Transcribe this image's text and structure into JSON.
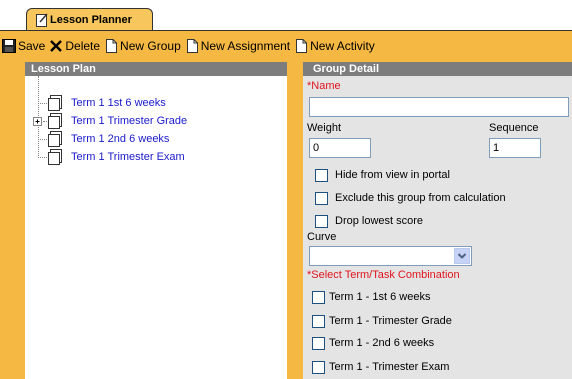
{
  "tab": {
    "label": "Lesson Planner",
    "icon": "pencil-note-icon"
  },
  "toolbar": {
    "save": "Save",
    "delete": "Delete",
    "new_group": "New Group",
    "new_assignment": "New Assignment",
    "new_activity": "New Activity"
  },
  "lesson_plan": {
    "header": "Lesson Plan",
    "items": [
      {
        "label": "Term 1 1st 6 weeks"
      },
      {
        "label": "Term 1 Trimester Grade"
      },
      {
        "label": "Term 1 2nd 6 weeks"
      },
      {
        "label": "Term 1 Trimester Exam"
      }
    ]
  },
  "group_detail": {
    "header": "Group Detail",
    "name_label": "*Name",
    "name_value": "",
    "weight_label": "Weight",
    "weight_value": "0",
    "sequence_label": "Sequence",
    "sequence_value": "1",
    "hide_label": "Hide from view in portal",
    "exclude_label": "Exclude this group from calculation",
    "drop_label": "Drop lowest score",
    "curve_label": "Curve",
    "curve_value": "",
    "term_task_label": "*Select Term/Task Combination",
    "terms": [
      {
        "label": "Term 1 - 1st 6 weeks"
      },
      {
        "label": "Term 1 - Trimester Grade"
      },
      {
        "label": "Term 1 - 2nd 6 weeks"
      },
      {
        "label": "Term 1 - Trimester Exam"
      }
    ]
  },
  "colors": {
    "frame": "#f5b843",
    "tab": "#f7c65c",
    "header": "#7d7d7d",
    "link": "#1a1acc",
    "required": "#e0141e"
  }
}
